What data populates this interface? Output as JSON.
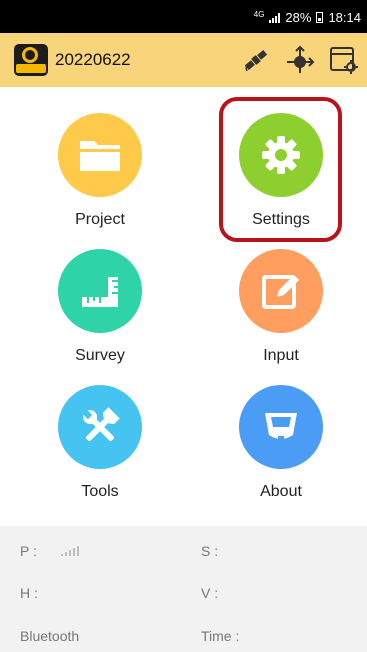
{
  "status_bar": {
    "network": "4G",
    "battery": "28%",
    "time": "18:14"
  },
  "app_bar": {
    "title": "20220622",
    "icons": [
      "satellite-icon",
      "crosshair-icon",
      "window-settings-icon"
    ]
  },
  "menu": [
    {
      "label": "Project",
      "icon": "folder-icon",
      "color": "#ffc94a"
    },
    {
      "label": "Settings",
      "icon": "gear-icon",
      "color": "#8dcf2f"
    },
    {
      "label": "Survey",
      "icon": "ruler-icon",
      "color": "#2ed3a8"
    },
    {
      "label": "Input",
      "icon": "edit-icon",
      "color": "#ff9e5e"
    },
    {
      "label": "Tools",
      "icon": "tools-icon",
      "color": "#45c3f1"
    },
    {
      "label": "About",
      "icon": "receiver-icon",
      "color": "#4a9cf5"
    }
  ],
  "info": {
    "p_label": "P :",
    "s_label": "S :",
    "h_label": "H :",
    "v_label": "V :",
    "bluetooth_label": "Bluetooth",
    "time_label": "Time :"
  },
  "highlight_color": "#b7141b"
}
